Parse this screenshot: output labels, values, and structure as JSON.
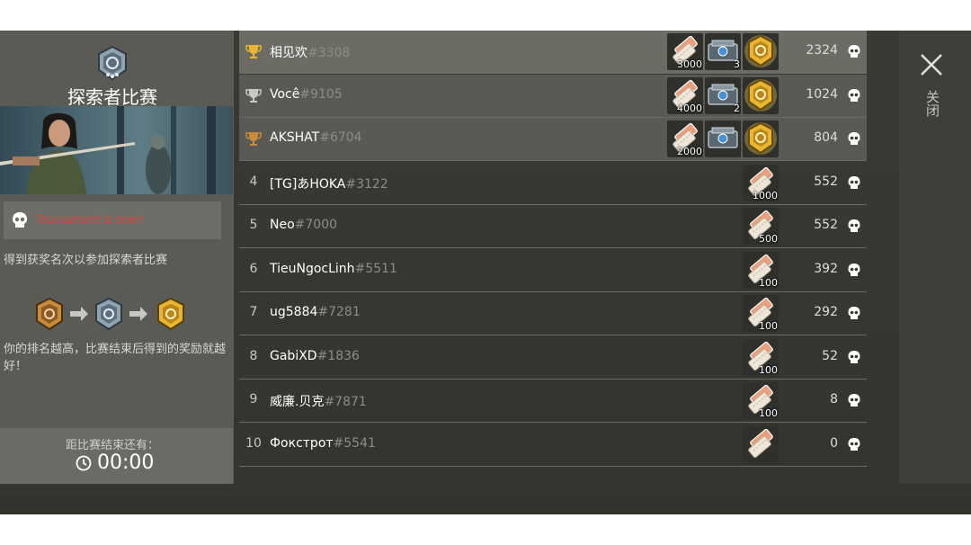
{
  "panel": {
    "title": "探索者比赛",
    "status": "Tournament is over!",
    "info": "得到获奖名次以参加探索者比赛",
    "rank_desc": "你的排名越高，比赛结束后得到的奖励就越好！",
    "timer_label": "距比赛结束还有：",
    "timer_value": "00:00"
  },
  "close_label": "关闭",
  "colors": {
    "gold": "#e8b630",
    "silver": "#c8c8c8",
    "bronze": "#c98a3a",
    "status_red": "#e0433c",
    "tag_gray": "#8d8d87"
  },
  "rows": [
    {
      "rank": "1",
      "name": "相见欢",
      "tag": "#3308",
      "score": "2324",
      "trophy": "gold",
      "tickets": "3000",
      "crates": "3",
      "medal": true
    },
    {
      "rank": "2",
      "name": "Você",
      "tag": "#9105",
      "score": "1024",
      "trophy": "silver",
      "tickets": "4000",
      "crates": "2",
      "medal": true
    },
    {
      "rank": "3",
      "name": "AKSHAT",
      "tag": "#6704",
      "score": "804",
      "trophy": "bronze",
      "tickets": "2000",
      "crates": "",
      "medal": true
    },
    {
      "rank": "4",
      "name": "[TG]あHOKA",
      "tag": "#3122",
      "score": "552",
      "trophy": "",
      "tickets": "1000",
      "crates": "",
      "medal": false
    },
    {
      "rank": "5",
      "name": "Neo",
      "tag": "#7000",
      "score": "552",
      "trophy": "",
      "tickets": "500",
      "crates": "",
      "medal": false
    },
    {
      "rank": "6",
      "name": "TieuNgocLinh",
      "tag": "#5511",
      "score": "392",
      "trophy": "",
      "tickets": "100",
      "crates": "",
      "medal": false
    },
    {
      "rank": "7",
      "name": "ug5884",
      "tag": "#7281",
      "score": "292",
      "trophy": "",
      "tickets": "100",
      "crates": "",
      "medal": false
    },
    {
      "rank": "8",
      "name": "GabiXD",
      "tag": "#1836",
      "score": "52",
      "trophy": "",
      "tickets": "100",
      "crates": "",
      "medal": false
    },
    {
      "rank": "9",
      "name": "威廉.贝克",
      "tag": "#7871",
      "score": "8",
      "trophy": "",
      "tickets": "100",
      "crates": "",
      "medal": false
    },
    {
      "rank": "10",
      "name": "Фокстрот",
      "tag": "#5541",
      "score": "0",
      "trophy": "",
      "tickets": "",
      "crates": "",
      "medal": false
    }
  ]
}
